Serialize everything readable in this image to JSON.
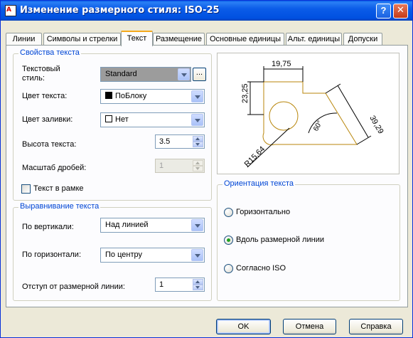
{
  "window": {
    "title": "Изменение размерного стиля: ISO-25",
    "help": "?",
    "close": "✕",
    "app_icon": "A"
  },
  "tabs": [
    {
      "label": "Линии"
    },
    {
      "label": "Символы и стрелки"
    },
    {
      "label": "Текст",
      "active": true
    },
    {
      "label": "Размещение"
    },
    {
      "label": "Основные единицы"
    },
    {
      "label": "Альт. единицы"
    },
    {
      "label": "Допуски"
    }
  ],
  "text_props": {
    "title": "Свойства текста",
    "style_label_1": "Текстовый",
    "style_label_2": "стиль:",
    "style_value": "Standard",
    "browse": "...",
    "color_label": "Цвет текста:",
    "color_value": "ПоБлоку",
    "fill_label": "Цвет заливки:",
    "fill_value": "Нет",
    "height_label": "Высота текста:",
    "height_value": "3.5",
    "fraction_label": "Масштаб дробей:",
    "fraction_value": "1",
    "frame_label": "Текст в рамке",
    "frame_checked": false
  },
  "alignment": {
    "title": "Выравнивание текста",
    "vertical_label": "По вертикали:",
    "vertical_value": "Над линией",
    "horizontal_label": "По горизонтали:",
    "horizontal_value": "По центру",
    "offset_label": "Отступ от размерной линии:",
    "offset_value": "1"
  },
  "orientation": {
    "title": "Ориентация текста",
    "options": [
      {
        "label": "Горизонтально",
        "checked": false
      },
      {
        "label": "Вдоль размерной линии",
        "checked": true
      },
      {
        "label": "Согласно ISO",
        "checked": false
      }
    ]
  },
  "preview": {
    "dim_top": "19,75",
    "dim_left": "23,25",
    "dim_right": "39,29",
    "dim_angle": "60°",
    "dim_radius": "R15,64",
    "shape_color": "#b8860b",
    "dim_color": "#000000"
  },
  "footer": {
    "ok": "OK",
    "cancel": "Отмена",
    "help": "Справка"
  }
}
